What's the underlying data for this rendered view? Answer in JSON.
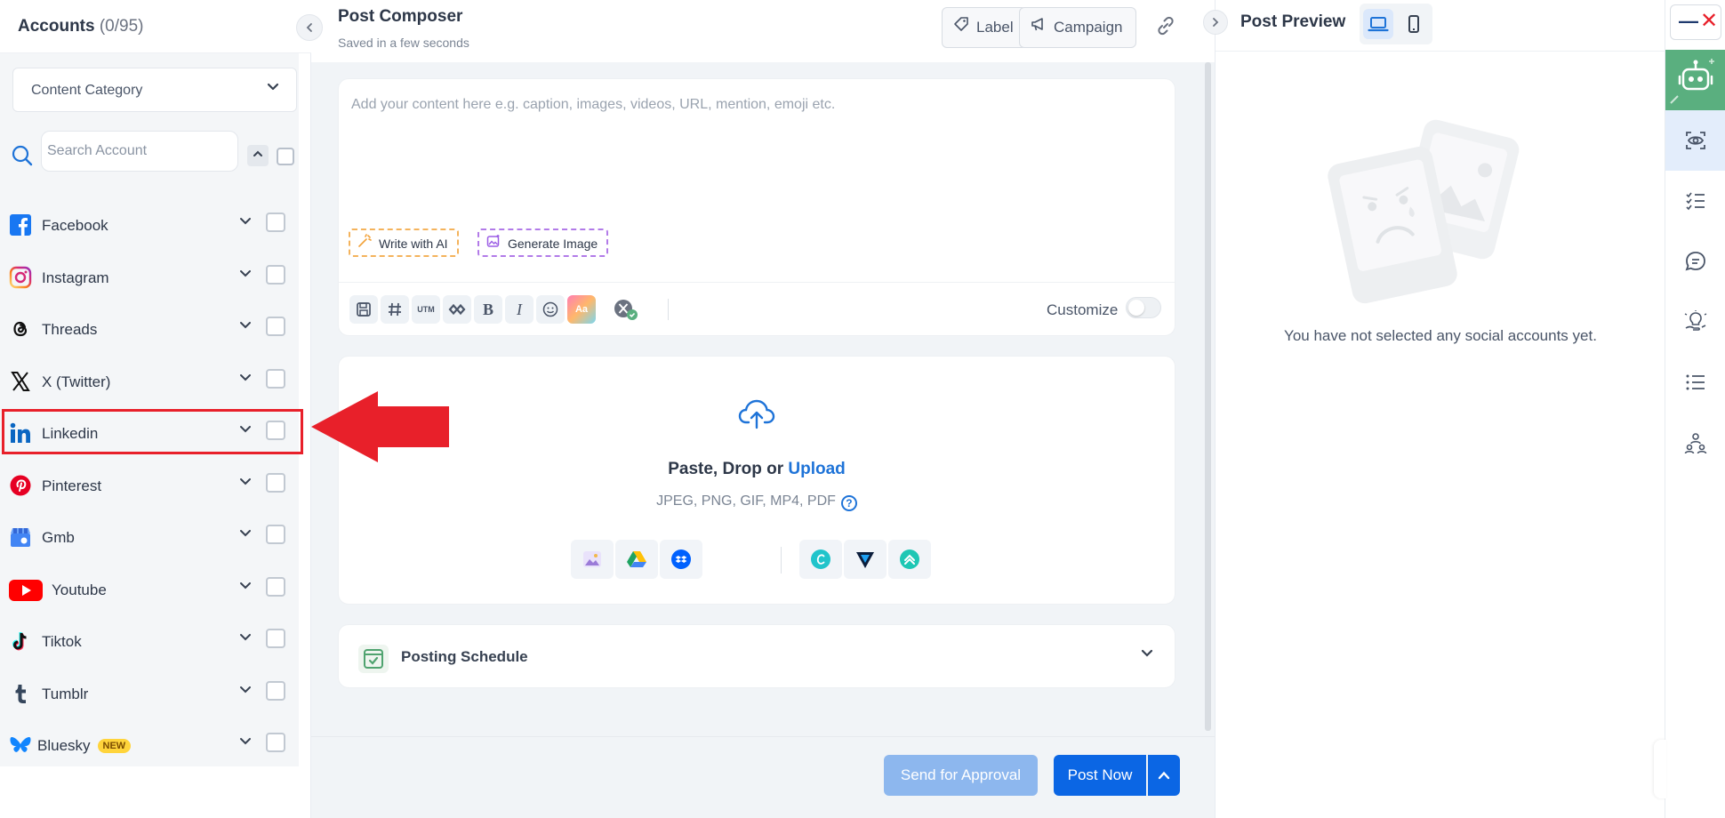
{
  "accounts": {
    "title": "Accounts",
    "count": "(0/95)",
    "category_placeholder": "Content Category",
    "search_placeholder": "Search Account",
    "platforms": [
      {
        "name": "Facebook",
        "icon": "facebook-icon",
        "color": "#1877f2"
      },
      {
        "name": "Instagram",
        "icon": "instagram-icon",
        "color": "#e1306c"
      },
      {
        "name": "Threads",
        "icon": "threads-icon",
        "color": "#000000"
      },
      {
        "name": "X (Twitter)",
        "icon": "x-twitter-icon",
        "color": "#000000"
      },
      {
        "name": "Linkedin",
        "icon": "linkedin-icon",
        "color": "#0a66c2"
      },
      {
        "name": "Pinterest",
        "icon": "pinterest-icon",
        "color": "#e60023"
      },
      {
        "name": "Gmb",
        "icon": "gmb-icon",
        "color": "#4285f4"
      },
      {
        "name": "Youtube",
        "icon": "youtube-icon",
        "color": "#ff0000"
      },
      {
        "name": "Tiktok",
        "icon": "tiktok-icon",
        "color": "#000000"
      },
      {
        "name": "Tumblr",
        "icon": "tumblr-icon",
        "color": "#35465c"
      },
      {
        "name": "Bluesky",
        "icon": "bluesky-icon",
        "color": "#1185fe",
        "badge": "NEW"
      }
    ],
    "highlighted_platform": "Linkedin",
    "highlight_color": "#e8202a"
  },
  "composer": {
    "title": "Post Composer",
    "subtitle": "Saved in a few seconds",
    "label_button": "Label",
    "campaign_button": "Campaign",
    "editor_placeholder": "Add your content here e.g. caption, images, videos, URL, mention, emoji etc.",
    "write_ai": "Write with AI",
    "generate_image": "Generate Image",
    "utm_label": "UTM",
    "bold_label": "B",
    "italic_label": "I",
    "font_label": "Aa",
    "customize": "Customize",
    "upload_prefix": "Paste, Drop or",
    "upload_link": "Upload",
    "formats": "JPEG, PNG, GIF, MP4, PDF",
    "help_icon_label": "?",
    "posting_schedule": "Posting Schedule",
    "send_approval": "Send for Approval",
    "post_now": "Post Now"
  },
  "preview": {
    "title": "Post Preview",
    "empty_message": "You have not selected any social accounts yet."
  },
  "colors": {
    "primary": "#0b66e4",
    "primary_light": "#8db7ee",
    "accent_green": "#5aaf7f",
    "link": "#1e73d8"
  }
}
